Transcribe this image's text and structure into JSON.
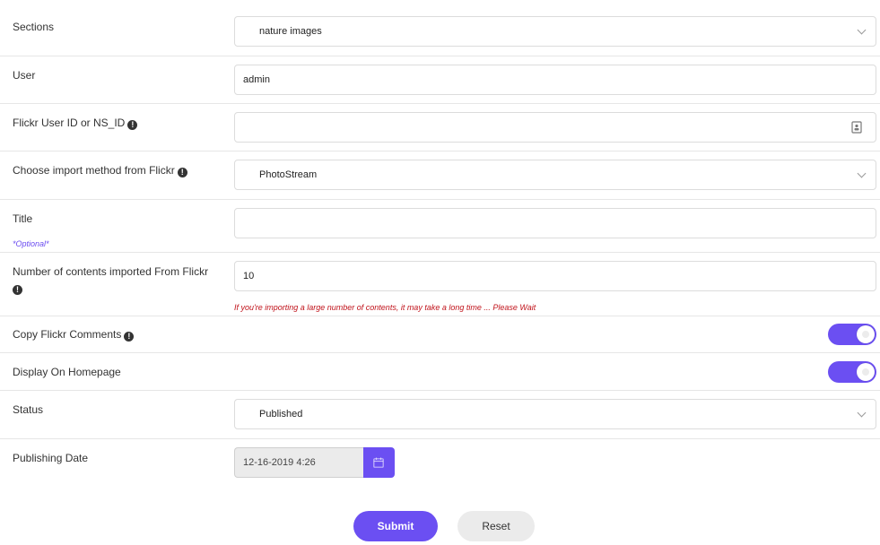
{
  "sections": {
    "label": "Sections",
    "value": "nature images"
  },
  "user": {
    "label": "User",
    "value": "admin"
  },
  "flickr_id": {
    "label": "Flickr User ID or NS_ID",
    "value": ""
  },
  "import_method": {
    "label": "Choose import method from Flickr",
    "value": "PhotoStream"
  },
  "title": {
    "label": "Title",
    "optional": "*Optional*",
    "value": ""
  },
  "count": {
    "label": "Number of contents imported From Flickr",
    "value": "10",
    "warning": "If you're importing a large number of contents, it may take a long time ... Please Wait"
  },
  "copy_comments": {
    "label": "Copy Flickr Comments",
    "enabled": true
  },
  "homepage": {
    "label": "Display On Homepage",
    "enabled": true
  },
  "status": {
    "label": "Status",
    "value": "Published"
  },
  "publishing_date": {
    "label": "Publishing Date",
    "value": "12-16-2019 4:26"
  },
  "buttons": {
    "submit": "Submit",
    "reset": "Reset"
  },
  "colors": {
    "accent": "#6b4ff2",
    "warning": "#c0121a",
    "optional": "#6b4cf0"
  },
  "icons": {
    "info": "info-circle-icon",
    "contact": "contact-card-icon",
    "calendar": "calendar-icon",
    "chevron": "chevron-down-icon"
  }
}
